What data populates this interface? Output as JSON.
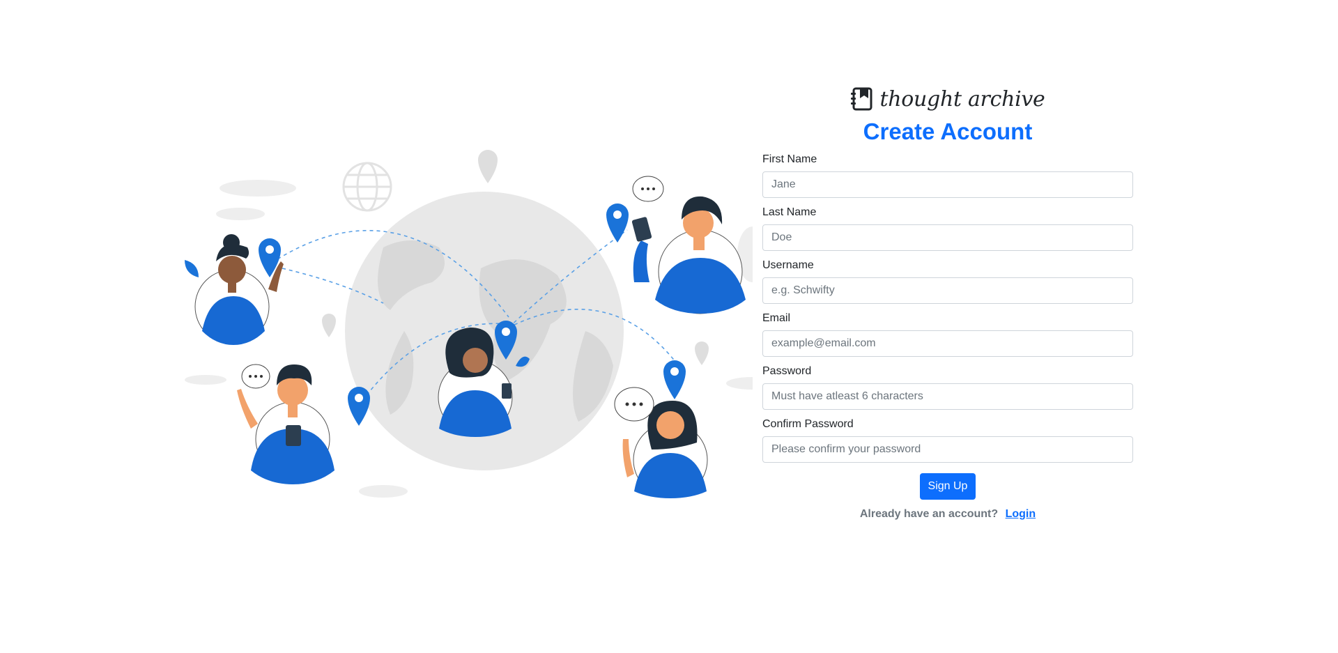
{
  "brand": {
    "name": "thought archive",
    "icon": "notebook-icon"
  },
  "page": {
    "title": "Create Account"
  },
  "form": {
    "fields": [
      {
        "label": "First Name",
        "placeholder": "Jane",
        "value": ""
      },
      {
        "label": "Last Name",
        "placeholder": "Doe",
        "value": ""
      },
      {
        "label": "Username",
        "placeholder": "e.g. Schwifty",
        "value": ""
      },
      {
        "label": "Email",
        "placeholder": "example@email.com",
        "value": ""
      },
      {
        "label": "Password",
        "placeholder": "Must have atleast 6 characters",
        "value": ""
      },
      {
        "label": "Confirm Password",
        "placeholder": "Please confirm your password",
        "value": ""
      }
    ],
    "submit_label": "Sign Up"
  },
  "footer": {
    "prompt": "Already have an account?",
    "login_label": "Login"
  },
  "colors": {
    "accent": "#0d6efd",
    "globe": "#e6e6e6",
    "pin": "#1a73d9",
    "shirt": "#1769d3",
    "muted": "#6c757d"
  },
  "illustration": {
    "description_icon": "people-around-globe-illustration"
  }
}
